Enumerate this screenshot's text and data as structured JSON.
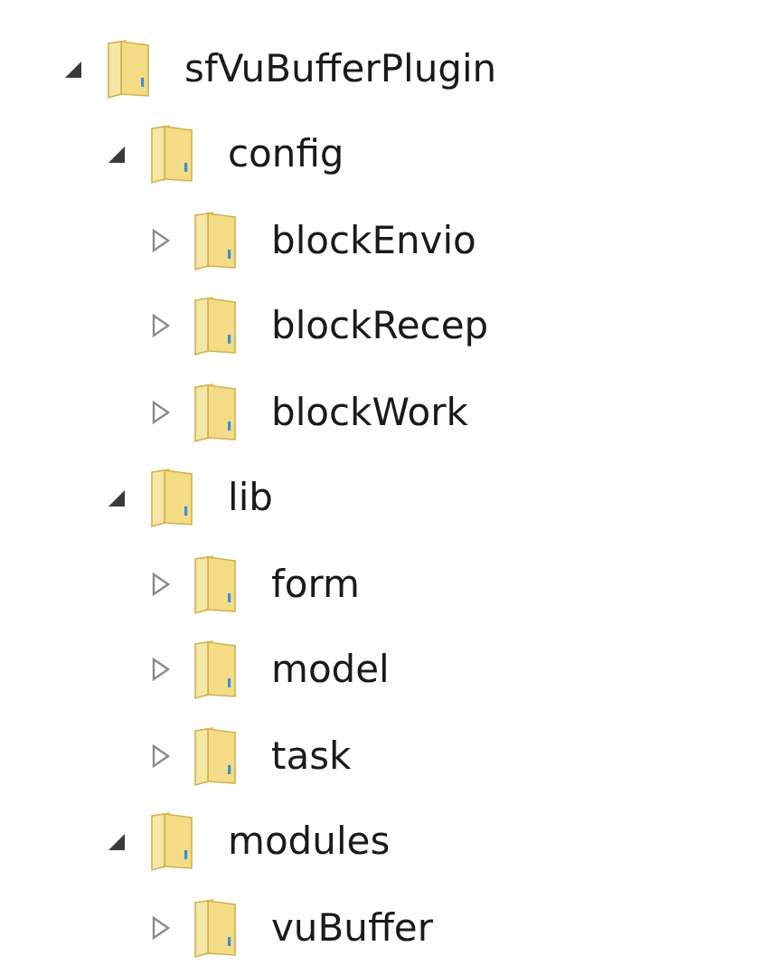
{
  "tree": [
    {
      "label": "sfVuBufferPlugin",
      "expanded": true,
      "children": [
        {
          "label": "config",
          "expanded": true,
          "children": [
            {
              "label": "blockEnvio",
              "expanded": false
            },
            {
              "label": "blockRecep",
              "expanded": false
            },
            {
              "label": "blockWork",
              "expanded": false
            }
          ]
        },
        {
          "label": "lib",
          "expanded": true,
          "children": [
            {
              "label": "form",
              "expanded": false
            },
            {
              "label": "model",
              "expanded": false
            },
            {
              "label": "task",
              "expanded": false
            }
          ]
        },
        {
          "label": "modules",
          "expanded": true,
          "children": [
            {
              "label": "vuBuffer",
              "expanded": false
            }
          ]
        }
      ]
    }
  ]
}
